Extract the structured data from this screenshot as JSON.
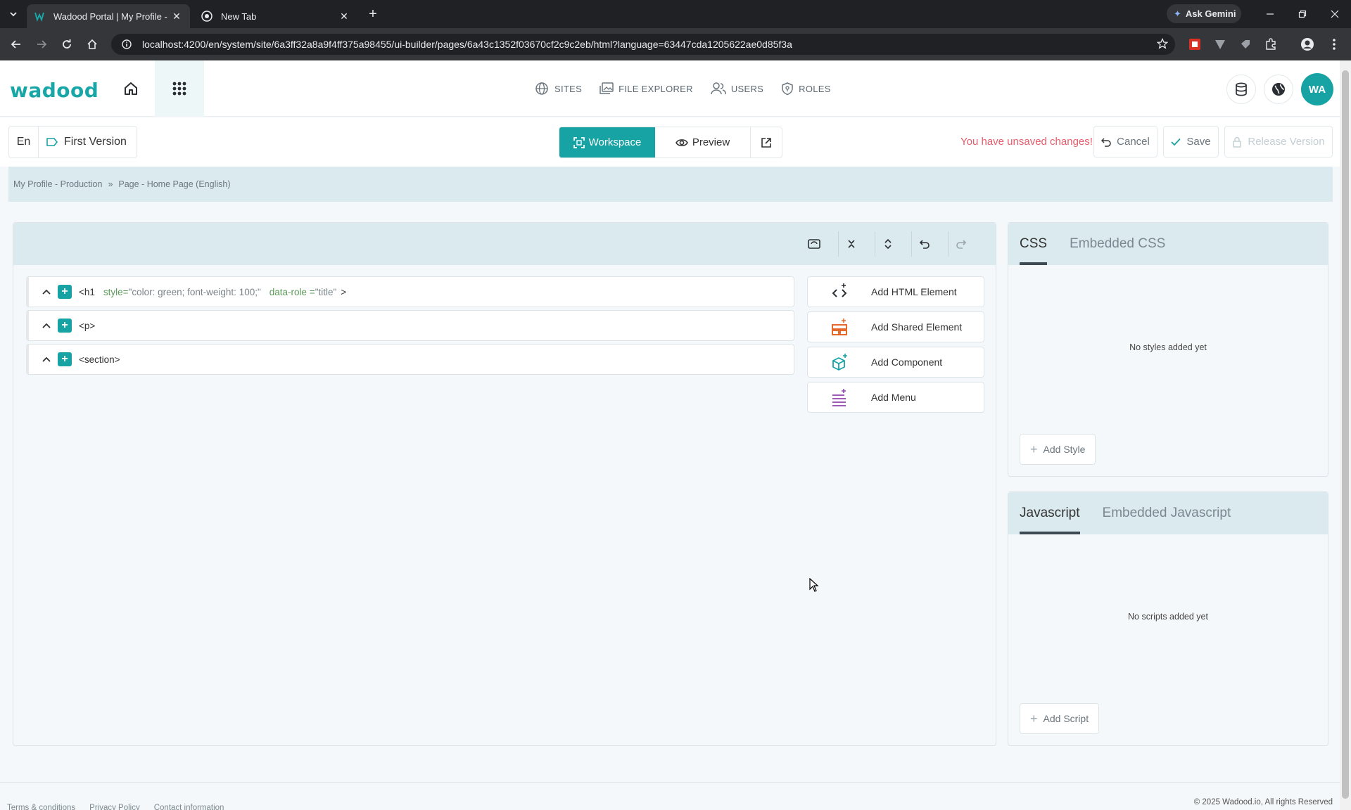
{
  "browser": {
    "tabs": [
      {
        "title": "Wadood Portal | My Profile - Ui",
        "active": true
      },
      {
        "title": "New Tab",
        "active": false
      }
    ],
    "gemini_label": "Ask Gemini",
    "url": "localhost:4200/en/system/site/6a3ff32a8a9f4ff375a98455/ui-builder/pages/6a43c1352f03670cf2c9c2eb/html?language=63447cda1205622ae0d85f3a"
  },
  "header": {
    "logo": "wadood",
    "nav": [
      {
        "label": "SITES",
        "icon": "globe-icon"
      },
      {
        "label": "FILE EXPLORER",
        "icon": "images-icon"
      },
      {
        "label": "USERS",
        "icon": "users-icon"
      },
      {
        "label": "ROLES",
        "icon": "shield-icon"
      }
    ],
    "avatar": "WA"
  },
  "pagebar": {
    "language": "En",
    "version": "First Version",
    "workspace_label": "Workspace",
    "preview_label": "Preview",
    "unsaved_text": "You have unsaved changes!",
    "cancel_label": "Cancel",
    "save_label": "Save",
    "release_label": "Release Version"
  },
  "breadcrumb": {
    "items": [
      "My Profile - Production",
      "Page - Home Page (English)"
    ],
    "separator": "»"
  },
  "tree": {
    "rows": [
      {
        "tag": "<h1",
        "attr1_name": "style=",
        "attr1_value": "\"color: green; font-weight: 100;\"",
        "attr2_name": "data-role =",
        "attr2_value": "\"title\"",
        "close": ">"
      },
      {
        "tag": "<p>"
      },
      {
        "tag": "<section>"
      }
    ]
  },
  "add_buttons": [
    {
      "label": "Add HTML Element",
      "icon": "code-plus-icon"
    },
    {
      "label": "Add Shared Element",
      "icon": "shared-element-icon"
    },
    {
      "label": "Add Component",
      "icon": "cube-plus-icon"
    },
    {
      "label": "Add Menu",
      "icon": "menu-plus-icon"
    }
  ],
  "css_panel": {
    "tabs": [
      "CSS",
      "Embedded CSS"
    ],
    "empty_text": "No styles added yet",
    "add_label": "Add Style"
  },
  "js_panel": {
    "tabs": [
      "Javascript",
      "Embedded Javascript"
    ],
    "empty_text": "No scripts added yet",
    "add_label": "Add Script"
  },
  "footer": {
    "links": [
      "Terms & conditions",
      "Privacy Policy",
      "Contact information"
    ],
    "copyright": "© 2025 Wadood.io, All rights Reserved"
  },
  "colors": {
    "accent": "#17a2a3",
    "panel_header": "#dbeaee",
    "warning": "#e35d6a"
  }
}
